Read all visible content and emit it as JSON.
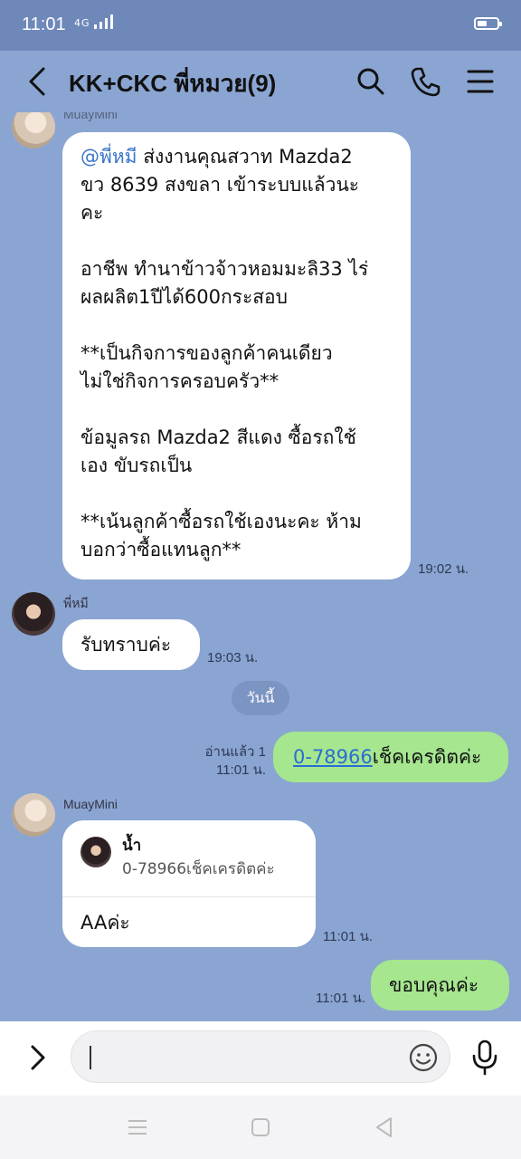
{
  "status_bar": {
    "time": "11:01",
    "network": "4G"
  },
  "header": {
    "title": "KK+CKC พี่หมวย(9)"
  },
  "messages": {
    "m1": {
      "sender": "MuayMini",
      "mention": "@พี่หมี",
      "lines": [
        " ส่งงานคุณสวาท Mazda2",
        "ขว 8639 สงขลา เข้าระบบแล้วนะ",
        "คะ",
        "",
        "อาชีพ ทำนาข้าวจ้าวหอมมะลิ33 ไร่",
        "ผลผลิต1ปีได้600กระสอบ",
        "",
        "**เป็นกิจการของลูกค้าคนเดียว",
        "ไม่ใช่กิจการครอบครัว**",
        "",
        "ข้อมูลรถ Mazda2 สีแดง ซื้อรถใช้",
        "เอง ขับรถเป็น",
        "",
        "**เน้นลูกค้าซื้อรถใช้เองนะคะ ห้าม",
        "บอกว่าซื้อแทนลูก**"
      ],
      "time": "19:02 น."
    },
    "m2": {
      "sender": "พี่หมี",
      "text": "รับทราบค่ะ",
      "time": "19:03 น."
    },
    "date_divider": "วันนี้",
    "m3": {
      "read": "อ่านแล้ว 1",
      "time": "11:01 น.",
      "link": "0-78966",
      "text": "เช็คเครดิตค่ะ"
    },
    "m4": {
      "sender": "MuayMini",
      "quote_name": "น้ำ",
      "quote_text": "0-78966เช็คเครดิตค่ะ",
      "text": "AAค่ะ",
      "time": "11:01 น."
    },
    "m5": {
      "time": "11:01 น.",
      "text": "ขอบคุณค่ะ"
    }
  },
  "colors": {
    "chat_bg": "#8aa5d2",
    "status_bg": "#6e88b9",
    "my_bubble": "#a5e68f",
    "other_bubble": "#ffffff",
    "link": "#2b6cd6"
  }
}
